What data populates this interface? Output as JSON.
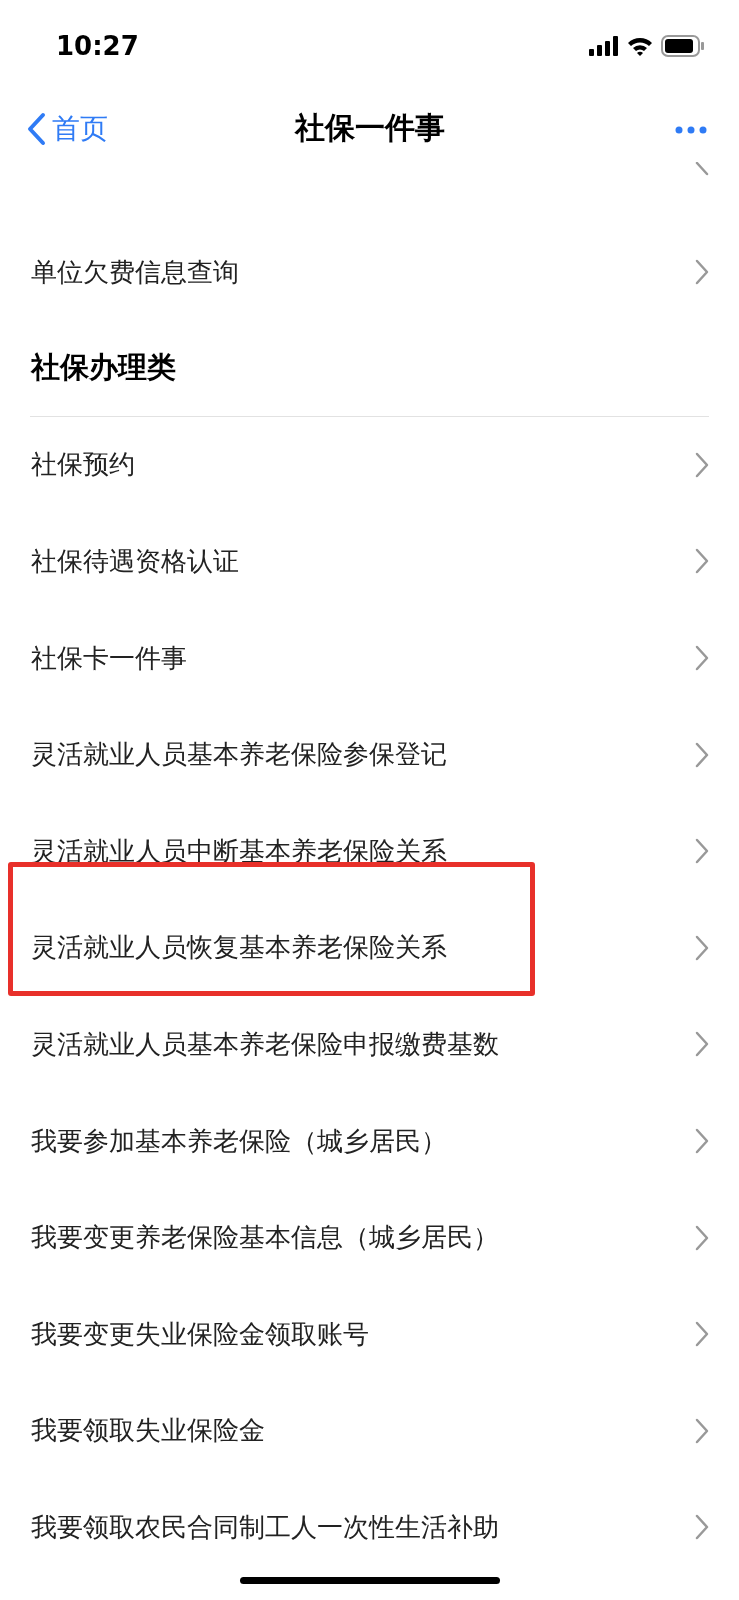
{
  "status_bar": {
    "time": "10:27"
  },
  "nav": {
    "back_label": "首页",
    "title": "社保一件事"
  },
  "top_items": [
    {
      "label": "单位欠费信息查询"
    }
  ],
  "section": {
    "title": "社保办理类",
    "items": [
      {
        "label": "社保预约",
        "highlighted": false
      },
      {
        "label": "社保待遇资格认证",
        "highlighted": false
      },
      {
        "label": "社保卡一件事",
        "highlighted": false
      },
      {
        "label": "灵活就业人员基本养老保险参保登记",
        "highlighted": false
      },
      {
        "label": "灵活就业人员中断基本养老保险关系",
        "highlighted": false
      },
      {
        "label": "灵活就业人员恢复基本养老保险关系",
        "highlighted": true
      },
      {
        "label": "灵活就业人员基本养老保险申报缴费基数",
        "highlighted": false
      },
      {
        "label": "我要参加基本养老保险（城乡居民）",
        "highlighted": false
      },
      {
        "label": "我要变更养老保险基本信息（城乡居民）",
        "highlighted": false
      },
      {
        "label": "我要变更失业保险金领取账号",
        "highlighted": false
      },
      {
        "label": "我要领取失业保险金",
        "highlighted": false
      },
      {
        "label": "我要领取农民合同制工人一次性生活补助",
        "highlighted": false
      }
    ]
  }
}
